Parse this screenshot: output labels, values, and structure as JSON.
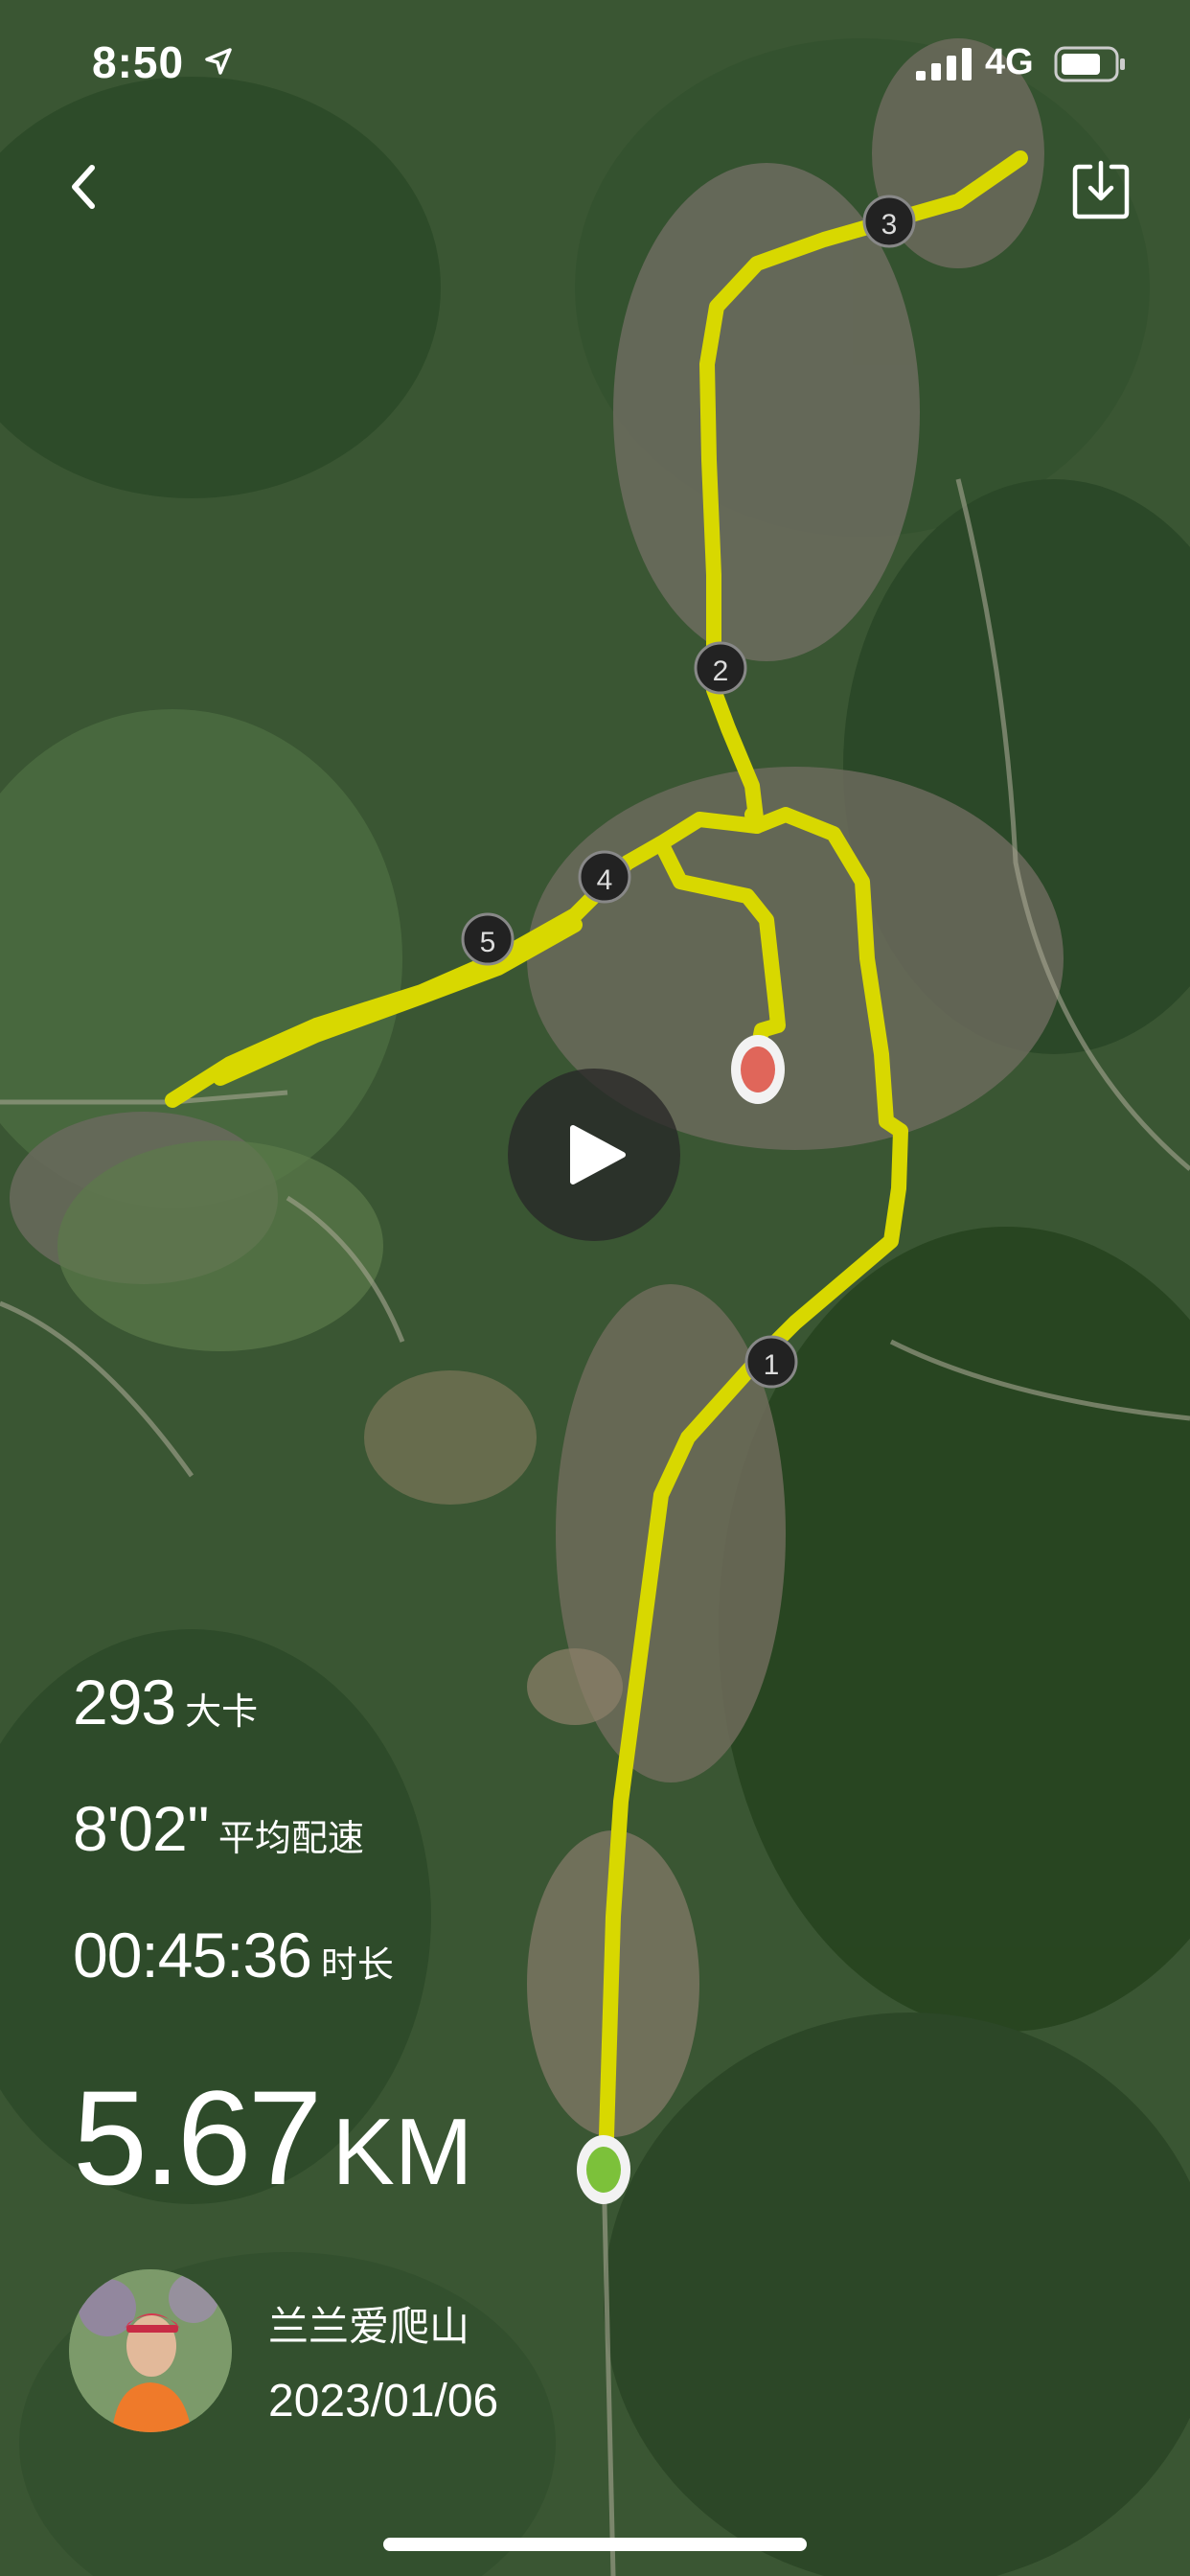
{
  "status_bar": {
    "time": "8:50",
    "network": "4G"
  },
  "stats": {
    "calories_value": "293",
    "calories_unit": "大卡",
    "pace_value": "8'02''",
    "pace_unit": "平均配速",
    "duration_value": "00:45:36",
    "duration_unit": "时长",
    "distance_value": "5.67",
    "distance_unit": "KM"
  },
  "user": {
    "name": "兰兰爱爬山",
    "date": "2023/01/06"
  },
  "map": {
    "km_markers": [
      "1",
      "2",
      "3",
      "4",
      "5"
    ],
    "route_color": "#d8d800",
    "start_color": "#7cc13a",
    "end_color": "#e0665a"
  },
  "icons": {
    "back": "chevron-left-icon",
    "download": "download-icon",
    "play": "play-icon",
    "location": "location-arrow-icon",
    "signal": "cellular-signal-icon",
    "battery": "battery-icon"
  }
}
